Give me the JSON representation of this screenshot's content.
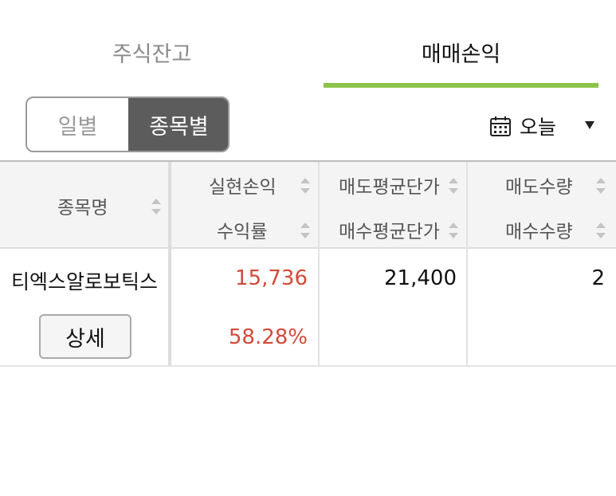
{
  "tabs": [
    {
      "label": "주식잔고",
      "active": false
    },
    {
      "label": "매매손익",
      "active": true
    }
  ],
  "period_toggle": {
    "daily": "일별",
    "by_stock": "종목별",
    "selected": "종목별"
  },
  "date_filter": {
    "label": "오늘",
    "icon": "calendar-icon"
  },
  "table": {
    "headers": {
      "name": "종목명",
      "realized_pl": "실현손익",
      "return_rate": "수익률",
      "avg_sell_price": "매도평균단가",
      "avg_buy_price": "매수평균단가",
      "sell_qty": "매도수량",
      "buy_qty": "매수수량"
    },
    "rows": [
      {
        "name": "티엑스알로보틱스",
        "detail_label": "상세",
        "realized_pl": "15,736",
        "return_rate": "58.28%",
        "avg_sell_price": "21,400",
        "avg_buy_price": "",
        "sell_qty": "2",
        "buy_qty": ""
      }
    ]
  },
  "colors": {
    "accent": "#8cc34a",
    "profit": "#d24a3a",
    "toggle_active": "#5c5c5c"
  }
}
